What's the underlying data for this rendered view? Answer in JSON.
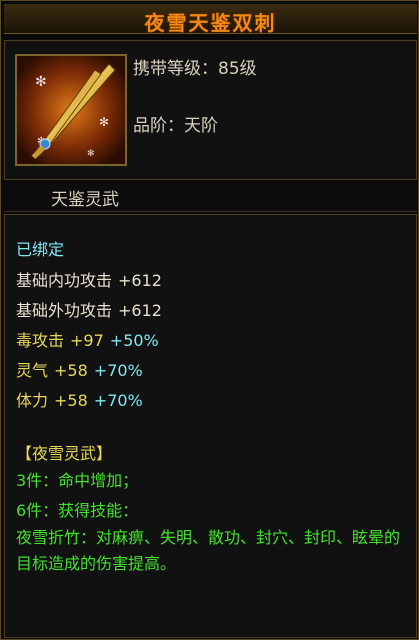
{
  "item": {
    "name": "夜雪天鉴双刺",
    "level_line": "携带等级：85级",
    "grade_line": "品阶：天阶",
    "category": "天鉴灵武"
  },
  "details": {
    "bound": "已绑定",
    "stats": [
      {
        "name": "基础内功攻击",
        "value": "+612",
        "bonus": ""
      },
      {
        "name": "基础外功攻击",
        "value": "+612",
        "bonus": ""
      },
      {
        "name": "毒攻击",
        "value": "+97",
        "bonus": "+50%"
      },
      {
        "name": "灵气",
        "value": "+58",
        "bonus": "+70%"
      },
      {
        "name": "体力",
        "value": "+58",
        "bonus": "+70%"
      }
    ],
    "set_title": "【夜雪灵武】",
    "set_lines": [
      "3件：命中增加；",
      "6件：获得技能：",
      "夜雪折竹：对麻痹、失明、散功、封穴、封印、眩晕的目标造成的伤害提高。"
    ]
  },
  "colors": {
    "title": "#f08a12",
    "cyan": "#7fe6f2",
    "yellow": "#e6d85a",
    "green": "#44e02e"
  },
  "icons": [
    "dual-dagger-weapon-icon"
  ]
}
